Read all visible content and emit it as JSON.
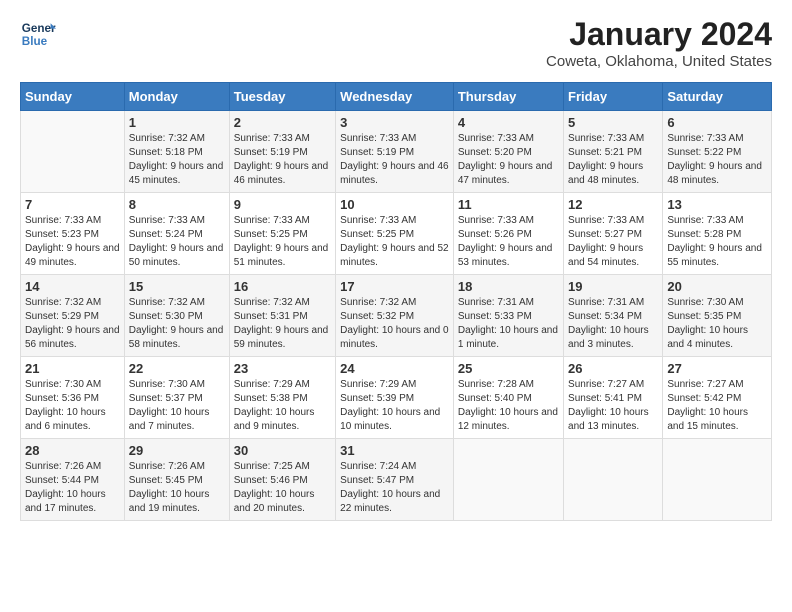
{
  "logo": {
    "text_general": "General",
    "text_blue": "Blue"
  },
  "header": {
    "title": "January 2024",
    "subtitle": "Coweta, Oklahoma, United States"
  },
  "weekdays": [
    "Sunday",
    "Monday",
    "Tuesday",
    "Wednesday",
    "Thursday",
    "Friday",
    "Saturday"
  ],
  "weeks": [
    [
      {
        "day": "",
        "sunrise": "",
        "sunset": "",
        "daylight": ""
      },
      {
        "day": "1",
        "sunrise": "Sunrise: 7:32 AM",
        "sunset": "Sunset: 5:18 PM",
        "daylight": "Daylight: 9 hours and 45 minutes."
      },
      {
        "day": "2",
        "sunrise": "Sunrise: 7:33 AM",
        "sunset": "Sunset: 5:19 PM",
        "daylight": "Daylight: 9 hours and 46 minutes."
      },
      {
        "day": "3",
        "sunrise": "Sunrise: 7:33 AM",
        "sunset": "Sunset: 5:19 PM",
        "daylight": "Daylight: 9 hours and 46 minutes."
      },
      {
        "day": "4",
        "sunrise": "Sunrise: 7:33 AM",
        "sunset": "Sunset: 5:20 PM",
        "daylight": "Daylight: 9 hours and 47 minutes."
      },
      {
        "day": "5",
        "sunrise": "Sunrise: 7:33 AM",
        "sunset": "Sunset: 5:21 PM",
        "daylight": "Daylight: 9 hours and 48 minutes."
      },
      {
        "day": "6",
        "sunrise": "Sunrise: 7:33 AM",
        "sunset": "Sunset: 5:22 PM",
        "daylight": "Daylight: 9 hours and 48 minutes."
      }
    ],
    [
      {
        "day": "7",
        "sunrise": "Sunrise: 7:33 AM",
        "sunset": "Sunset: 5:23 PM",
        "daylight": "Daylight: 9 hours and 49 minutes."
      },
      {
        "day": "8",
        "sunrise": "Sunrise: 7:33 AM",
        "sunset": "Sunset: 5:24 PM",
        "daylight": "Daylight: 9 hours and 50 minutes."
      },
      {
        "day": "9",
        "sunrise": "Sunrise: 7:33 AM",
        "sunset": "Sunset: 5:25 PM",
        "daylight": "Daylight: 9 hours and 51 minutes."
      },
      {
        "day": "10",
        "sunrise": "Sunrise: 7:33 AM",
        "sunset": "Sunset: 5:25 PM",
        "daylight": "Daylight: 9 hours and 52 minutes."
      },
      {
        "day": "11",
        "sunrise": "Sunrise: 7:33 AM",
        "sunset": "Sunset: 5:26 PM",
        "daylight": "Daylight: 9 hours and 53 minutes."
      },
      {
        "day": "12",
        "sunrise": "Sunrise: 7:33 AM",
        "sunset": "Sunset: 5:27 PM",
        "daylight": "Daylight: 9 hours and 54 minutes."
      },
      {
        "day": "13",
        "sunrise": "Sunrise: 7:33 AM",
        "sunset": "Sunset: 5:28 PM",
        "daylight": "Daylight: 9 hours and 55 minutes."
      }
    ],
    [
      {
        "day": "14",
        "sunrise": "Sunrise: 7:32 AM",
        "sunset": "Sunset: 5:29 PM",
        "daylight": "Daylight: 9 hours and 56 minutes."
      },
      {
        "day": "15",
        "sunrise": "Sunrise: 7:32 AM",
        "sunset": "Sunset: 5:30 PM",
        "daylight": "Daylight: 9 hours and 58 minutes."
      },
      {
        "day": "16",
        "sunrise": "Sunrise: 7:32 AM",
        "sunset": "Sunset: 5:31 PM",
        "daylight": "Daylight: 9 hours and 59 minutes."
      },
      {
        "day": "17",
        "sunrise": "Sunrise: 7:32 AM",
        "sunset": "Sunset: 5:32 PM",
        "daylight": "Daylight: 10 hours and 0 minutes."
      },
      {
        "day": "18",
        "sunrise": "Sunrise: 7:31 AM",
        "sunset": "Sunset: 5:33 PM",
        "daylight": "Daylight: 10 hours and 1 minute."
      },
      {
        "day": "19",
        "sunrise": "Sunrise: 7:31 AM",
        "sunset": "Sunset: 5:34 PM",
        "daylight": "Daylight: 10 hours and 3 minutes."
      },
      {
        "day": "20",
        "sunrise": "Sunrise: 7:30 AM",
        "sunset": "Sunset: 5:35 PM",
        "daylight": "Daylight: 10 hours and 4 minutes."
      }
    ],
    [
      {
        "day": "21",
        "sunrise": "Sunrise: 7:30 AM",
        "sunset": "Sunset: 5:36 PM",
        "daylight": "Daylight: 10 hours and 6 minutes."
      },
      {
        "day": "22",
        "sunrise": "Sunrise: 7:30 AM",
        "sunset": "Sunset: 5:37 PM",
        "daylight": "Daylight: 10 hours and 7 minutes."
      },
      {
        "day": "23",
        "sunrise": "Sunrise: 7:29 AM",
        "sunset": "Sunset: 5:38 PM",
        "daylight": "Daylight: 10 hours and 9 minutes."
      },
      {
        "day": "24",
        "sunrise": "Sunrise: 7:29 AM",
        "sunset": "Sunset: 5:39 PM",
        "daylight": "Daylight: 10 hours and 10 minutes."
      },
      {
        "day": "25",
        "sunrise": "Sunrise: 7:28 AM",
        "sunset": "Sunset: 5:40 PM",
        "daylight": "Daylight: 10 hours and 12 minutes."
      },
      {
        "day": "26",
        "sunrise": "Sunrise: 7:27 AM",
        "sunset": "Sunset: 5:41 PM",
        "daylight": "Daylight: 10 hours and 13 minutes."
      },
      {
        "day": "27",
        "sunrise": "Sunrise: 7:27 AM",
        "sunset": "Sunset: 5:42 PM",
        "daylight": "Daylight: 10 hours and 15 minutes."
      }
    ],
    [
      {
        "day": "28",
        "sunrise": "Sunrise: 7:26 AM",
        "sunset": "Sunset: 5:44 PM",
        "daylight": "Daylight: 10 hours and 17 minutes."
      },
      {
        "day": "29",
        "sunrise": "Sunrise: 7:26 AM",
        "sunset": "Sunset: 5:45 PM",
        "daylight": "Daylight: 10 hours and 19 minutes."
      },
      {
        "day": "30",
        "sunrise": "Sunrise: 7:25 AM",
        "sunset": "Sunset: 5:46 PM",
        "daylight": "Daylight: 10 hours and 20 minutes."
      },
      {
        "day": "31",
        "sunrise": "Sunrise: 7:24 AM",
        "sunset": "Sunset: 5:47 PM",
        "daylight": "Daylight: 10 hours and 22 minutes."
      },
      {
        "day": "",
        "sunrise": "",
        "sunset": "",
        "daylight": ""
      },
      {
        "day": "",
        "sunrise": "",
        "sunset": "",
        "daylight": ""
      },
      {
        "day": "",
        "sunrise": "",
        "sunset": "",
        "daylight": ""
      }
    ]
  ]
}
